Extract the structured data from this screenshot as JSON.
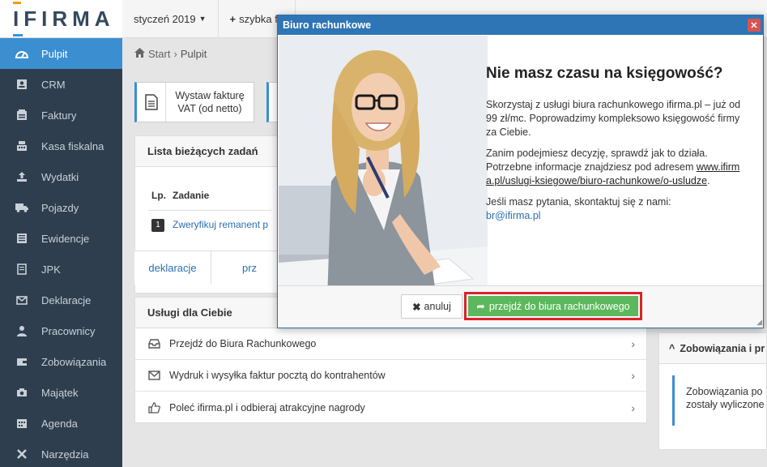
{
  "logo": {
    "text": "IFIRMA"
  },
  "topbar": {
    "month": "styczeń 2019",
    "quick": "szybka fa"
  },
  "sidebar": {
    "items": [
      {
        "label": "Pulpit",
        "icon": "dashboard-icon",
        "active": true
      },
      {
        "label": "CRM",
        "icon": "contact-card-icon"
      },
      {
        "label": "Faktury",
        "icon": "invoice-icon"
      },
      {
        "label": "Kasa fiskalna",
        "icon": "cash-register-icon"
      },
      {
        "label": "Wydatki",
        "icon": "upload-icon"
      },
      {
        "label": "Pojazdy",
        "icon": "truck-icon"
      },
      {
        "label": "Ewidencje",
        "icon": "ledger-icon"
      },
      {
        "label": "JPK",
        "icon": "document-icon"
      },
      {
        "label": "Deklaracje",
        "icon": "declaration-icon"
      },
      {
        "label": "Pracownicy",
        "icon": "user-icon"
      },
      {
        "label": "Zobowiązania",
        "icon": "wallet-icon"
      },
      {
        "label": "Majątek",
        "icon": "camera-icon"
      },
      {
        "label": "Agenda",
        "icon": "calendar-icon"
      },
      {
        "label": "Narzędzia",
        "icon": "tools-icon"
      }
    ]
  },
  "breadcrumb": {
    "home": "Start",
    "current": "Pulpit"
  },
  "actions": {
    "invoice_line1": "Wystaw fakturę",
    "invoice_line2": "VAT (od netto)"
  },
  "tasks": {
    "title": "Lista bieżących zadań",
    "col_lp": "Lp.",
    "col_task": "Zadanie",
    "row_num": "1",
    "row_task": "Zweryfikuj remanent p"
  },
  "tabs": {
    "declarations": "deklaracje",
    "second": "prz"
  },
  "services": {
    "title": "Usługi dla Ciebie",
    "items": [
      {
        "label": "Przejdź do Biura Rachunkowego",
        "icon": "inbox-icon"
      },
      {
        "label": "Wydruk i wysyłka faktur pocztą do kontrahentów",
        "icon": "envelope-icon"
      },
      {
        "label": "Poleć ifirma.pl i odbieraj atrakcyjne nagrody",
        "icon": "thumbs-up-icon"
      }
    ]
  },
  "obligations": {
    "title": "Zobowiązania i pr",
    "line1": "Zobowiązania po",
    "line2": "zostały wyliczone"
  },
  "modal": {
    "title": "Biuro rachunkowe",
    "heading": "Nie masz czasu na księgowość?",
    "p1": "Skorzystaj z usługi biura rachunkowego ifirma.pl – już od 99 zł/mc. Poprowadzimy kompleksowo księgowość firmy za Ciebie.",
    "p2": "Zanim podejmiesz decyzję, sprawdź jak to działa. Potrzebne informacje znajdziesz pod adresem",
    "link": "www.ifirma.pl/uslugi-ksiegowe/biuro-rachunkowe/o-usludze",
    "p2_end": ".",
    "p3": "Jeśli masz pytania, skontaktuj się z nami:",
    "email": "br@ifirma.pl",
    "cancel": "anuluj",
    "go": "przejdź do biura rachunkowego"
  },
  "colors": {
    "sidebar": "#2f3e4e",
    "accent": "#3b8fd1",
    "modal_header": "#2e75b6",
    "go_button": "#5cb85c",
    "highlight": "#d9232d"
  }
}
